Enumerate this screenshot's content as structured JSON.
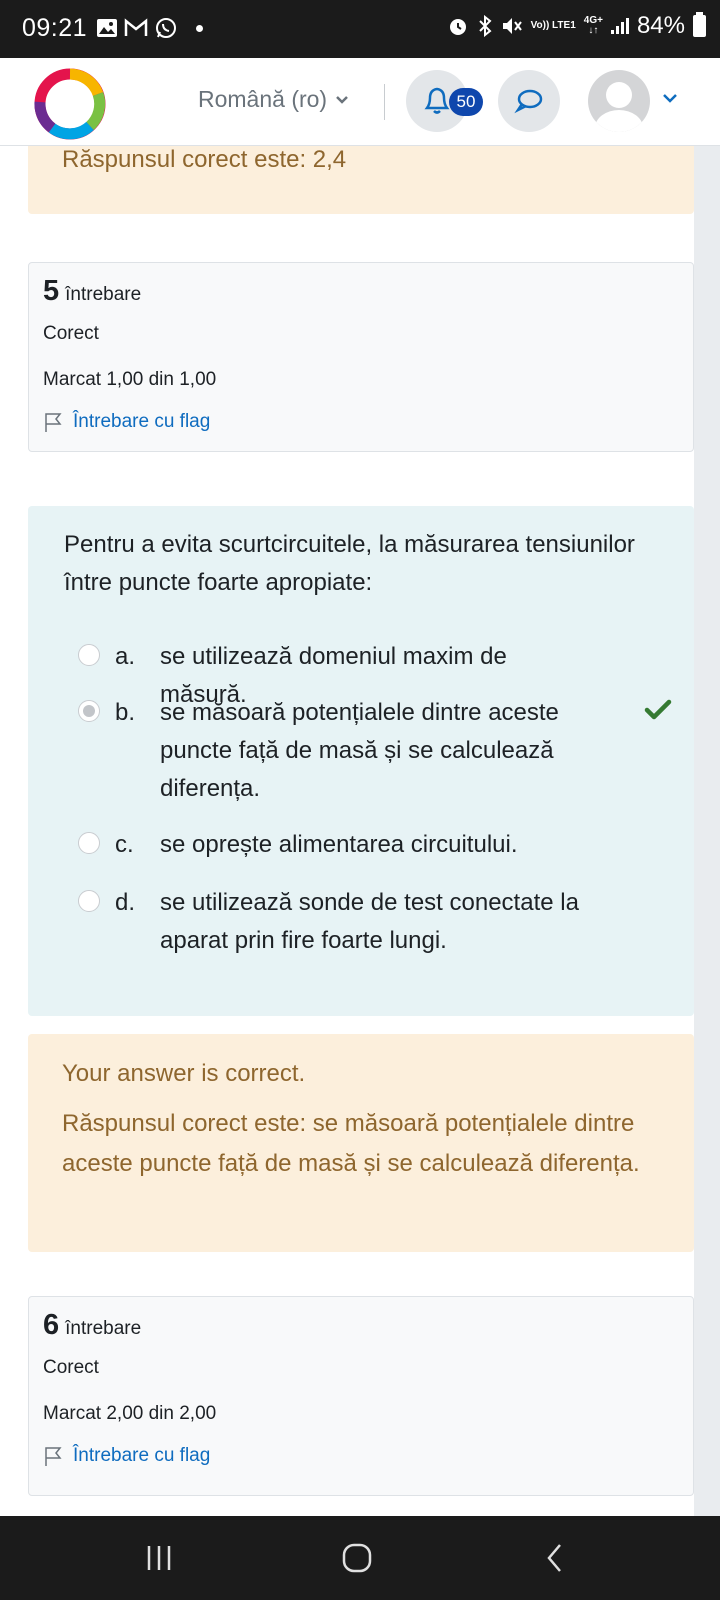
{
  "status_bar": {
    "time": "09:21",
    "battery": "84%",
    "network_volte": "Vo)) LTE1",
    "network_type": "4G+"
  },
  "header": {
    "language": "Română (ro)",
    "notification_count": "50",
    "logo_icon": "colorful-ring-logo"
  },
  "previous_feedback": {
    "correct_answer": "Răspunsul corect este: 2,4"
  },
  "question5": {
    "number": "5",
    "label": "întrebare",
    "state": "Corect",
    "grade": "Marcat 1,00 din 1,00",
    "flag_label": "Întrebare cu flag",
    "text": "Pentru a evita scurtcircuitele, la măsurarea tensiunilor între puncte foarte apropiate:",
    "options": [
      {
        "letter": "a.",
        "text": "se utilizează domeniul maxim de măsură.",
        "selected": false
      },
      {
        "letter": "b.",
        "text": "se măsoară potențialele dintre aceste puncte față de masă și se calculează diferența.",
        "selected": true,
        "correct": true
      },
      {
        "letter": "c.",
        "text": "se oprește alimentarea circuitului.",
        "selected": false
      },
      {
        "letter": "d.",
        "text": "se utilizează sonde de test conectate la aparat prin fire foarte lungi.",
        "selected": false
      }
    ],
    "feedback_status": "Your answer is correct.",
    "feedback_correct": "Răspunsul corect este: se măsoară potențialele dintre aceste puncte față de masă și se calculează diferența."
  },
  "question6": {
    "number": "6",
    "label": "întrebare",
    "state": "Corect",
    "grade": "Marcat 2,00 din 2,00",
    "flag_label": "Întrebare cu flag"
  },
  "colors": {
    "feedback_bg": "#fcefdc",
    "feedback_text": "#8e662e",
    "formulation_bg": "#e7f3f5",
    "link": "#0f6cbf",
    "check": "#357a32",
    "badge": "#0f47ad"
  }
}
